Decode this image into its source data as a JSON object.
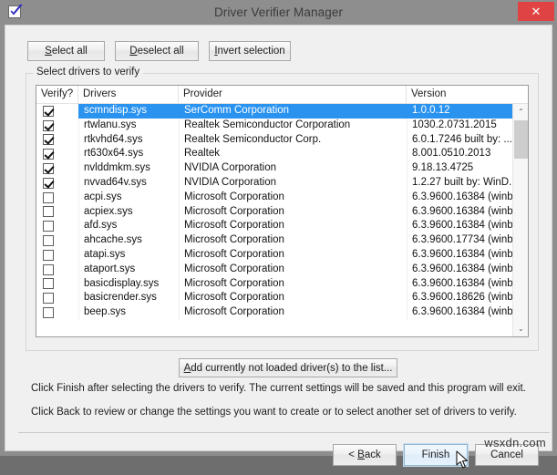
{
  "window": {
    "title": "Driver Verifier Manager",
    "icon": "verifier-checkbox-icon",
    "close_label": "✕"
  },
  "toolbar": {
    "select_all": "Select all",
    "select_all_accel": "S",
    "deselect_all": "Deselect all",
    "deselect_all_accel": "D",
    "invert_selection": "Invert selection",
    "invert_accel": "I"
  },
  "group": {
    "legend": "Select drivers to verify"
  },
  "list": {
    "columns": [
      "Verify?",
      "Drivers",
      "Provider",
      "Version"
    ],
    "rows": [
      {
        "checked": true,
        "selected": true,
        "driver": "scmndisp.sys",
        "provider": "SerComm Corporation",
        "version": "1.0.0.12"
      },
      {
        "checked": true,
        "selected": false,
        "driver": "rtwlanu.sys",
        "provider": "Realtek Semiconductor Corporation",
        "version": "1030.2.0731.2015"
      },
      {
        "checked": true,
        "selected": false,
        "driver": "rtkvhd64.sys",
        "provider": "Realtek Semiconductor Corp.",
        "version": "6.0.1.7246 built by: ..."
      },
      {
        "checked": true,
        "selected": false,
        "driver": "rt630x64.sys",
        "provider": "Realtek",
        "version": "8.001.0510.2013"
      },
      {
        "checked": true,
        "selected": false,
        "driver": "nvlddmkm.sys",
        "provider": "NVIDIA Corporation",
        "version": "9.18.13.4725"
      },
      {
        "checked": true,
        "selected": false,
        "driver": "nvvad64v.sys",
        "provider": "NVIDIA Corporation",
        "version": "1.2.27 built by: WinD..."
      },
      {
        "checked": false,
        "selected": false,
        "driver": "acpi.sys",
        "provider": "Microsoft Corporation",
        "version": "6.3.9600.16384 (winb..."
      },
      {
        "checked": false,
        "selected": false,
        "driver": "acpiex.sys",
        "provider": "Microsoft Corporation",
        "version": "6.3.9600.16384 (winb..."
      },
      {
        "checked": false,
        "selected": false,
        "driver": "afd.sys",
        "provider": "Microsoft Corporation",
        "version": "6.3.9600.16384 (winb..."
      },
      {
        "checked": false,
        "selected": false,
        "driver": "ahcache.sys",
        "provider": "Microsoft Corporation",
        "version": "6.3.9600.17734 (winb..."
      },
      {
        "checked": false,
        "selected": false,
        "driver": "atapi.sys",
        "provider": "Microsoft Corporation",
        "version": "6.3.9600.16384 (winb..."
      },
      {
        "checked": false,
        "selected": false,
        "driver": "ataport.sys",
        "provider": "Microsoft Corporation",
        "version": "6.3.9600.16384 (winb..."
      },
      {
        "checked": false,
        "selected": false,
        "driver": "basicdisplay.sys",
        "provider": "Microsoft Corporation",
        "version": "6.3.9600.16384 (winb..."
      },
      {
        "checked": false,
        "selected": false,
        "driver": "basicrender.sys",
        "provider": "Microsoft Corporation",
        "version": "6.3.9600.18626 (winb..."
      },
      {
        "checked": false,
        "selected": false,
        "driver": "beep.sys",
        "provider": "Microsoft Corporation",
        "version": "6.3.9600.16384 (winb..."
      }
    ],
    "scroll_up": "⌃",
    "scroll_down": "⌄"
  },
  "add_button": {
    "label": "Add currently not loaded driver(s) to the list...",
    "accel": "A"
  },
  "info": {
    "line1": "Click Finish after selecting the drivers to verify. The current settings will be saved and this program will exit.",
    "line2": "Click Back to review or change the settings you want to create or to select another set of drivers to verify."
  },
  "footer": {
    "back": "< Back",
    "back_accel": "B",
    "finish": "Finish",
    "cancel": "Cancel"
  },
  "watermark": "wsxdn.com",
  "colors": {
    "titlebar": "#8e8e8e",
    "close": "#e04343",
    "selection": "#2a93f0",
    "dialog": "#f0f0f0",
    "focus_button": "#e6f2fc"
  }
}
